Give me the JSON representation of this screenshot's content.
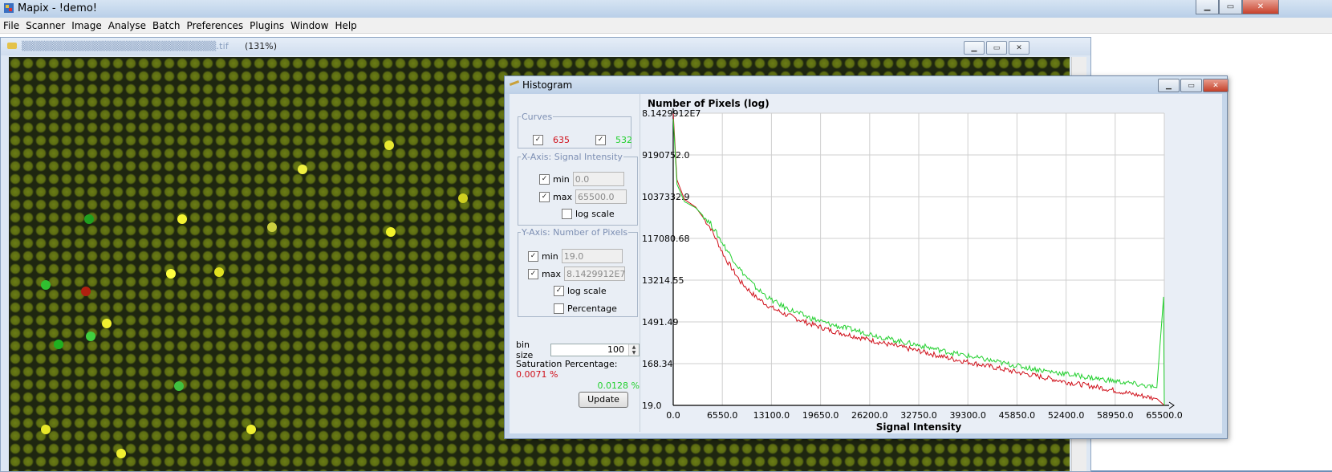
{
  "app": {
    "title": "Mapix - !demo!",
    "menu": [
      "File",
      "Scanner",
      "Image",
      "Analyse",
      "Batch",
      "Preferences",
      "Plugins",
      "Window",
      "Help"
    ]
  },
  "image_window": {
    "zoom": "(131%)",
    "filename_suffix": ".tif"
  },
  "histogram": {
    "title": "Histogram",
    "curves": {
      "legend": "Curves",
      "ch1_label": "635",
      "ch1_checked": "✓",
      "ch2_label": "532",
      "ch2_checked": "✓",
      "ch1_color": "#d0101a",
      "ch2_color": "#22d02e"
    },
    "x_axis": {
      "legend": "X-Axis: Signal Intensity",
      "min_label": "min",
      "min_value": "0.0",
      "max_label": "max",
      "max_value": "65500.0",
      "log_label": "log scale"
    },
    "y_axis": {
      "legend": "Y-Axis: Number of Pixels",
      "min_label": "min",
      "min_value": "19.0",
      "max_label": "max",
      "max_value": "8.1429912E7",
      "log_label": "log scale",
      "pct_label": "Percentage"
    },
    "bin_size_label": "bin size",
    "bin_size_value": "100",
    "saturation_label": "Saturation Percentage:",
    "saturation_635": "0.0071 %",
    "saturation_532": "0.0128 %",
    "update_label": "Update"
  },
  "chart_data": {
    "type": "line",
    "title": "Number of Pixels (log)",
    "xlabel": "Signal Intensity",
    "ylabel": "",
    "log_y": true,
    "xlim": [
      0,
      65500
    ],
    "ylim": [
      19,
      81429912
    ],
    "x_ticks": [
      "0.0",
      "6550.0",
      "13100.0",
      "19650.0",
      "26200.0",
      "32750.0",
      "39300.0",
      "45850.0",
      "52400.0",
      "58950.0",
      "65500.0"
    ],
    "y_ticks": [
      "8.1429912E7",
      "9190752.0",
      "1037332.9",
      "117080.68",
      "13214.55",
      "1491.49",
      "168.34",
      "19.0"
    ],
    "grid": true,
    "series": [
      {
        "name": "635",
        "color": "#d0101a",
        "x": [
          0,
          500,
          1500,
          3000,
          5000,
          7000,
          9000,
          11000,
          13000,
          15000,
          18000,
          21000,
          25000,
          29000,
          33000,
          37000,
          41000,
          45000,
          49000,
          53000,
          57000,
          61000,
          64500,
          65500
        ],
        "y": [
          80000000,
          2500000,
          900000,
          600000,
          200000,
          40000,
          12000,
          5500,
          3200,
          2200,
          1400,
          950,
          650,
          450,
          320,
          220,
          160,
          115,
          85,
          62,
          48,
          35,
          27,
          19
        ]
      },
      {
        "name": "532",
        "color": "#22d02e",
        "x": [
          0,
          500,
          1500,
          3000,
          5000,
          7000,
          9000,
          11000,
          13000,
          15000,
          18000,
          21000,
          25000,
          29000,
          33000,
          37000,
          41000,
          45000,
          49000,
          53000,
          57000,
          61000,
          64500,
          65400,
          65500
        ],
        "y": [
          60000000,
          2000000,
          800000,
          580000,
          250000,
          70000,
          22000,
          9000,
          4800,
          3100,
          1900,
          1300,
          900,
          600,
          430,
          300,
          220,
          160,
          120,
          95,
          75,
          60,
          48,
          5500,
          19
        ]
      }
    ]
  }
}
